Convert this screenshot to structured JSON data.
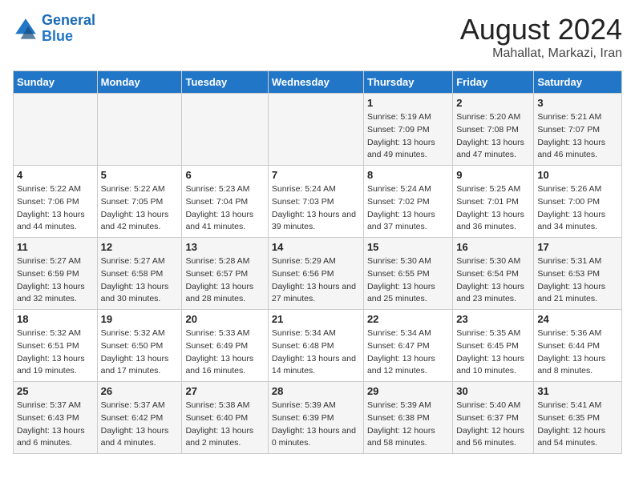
{
  "logo": {
    "line1": "General",
    "line2": "Blue"
  },
  "title": "August 2024",
  "subtitle": "Mahallat, Markazi, Iran",
  "days_of_week": [
    "Sunday",
    "Monday",
    "Tuesday",
    "Wednesday",
    "Thursday",
    "Friday",
    "Saturday"
  ],
  "weeks": [
    [
      {
        "day": "",
        "sunrise": "",
        "sunset": "",
        "daylight": ""
      },
      {
        "day": "",
        "sunrise": "",
        "sunset": "",
        "daylight": ""
      },
      {
        "day": "",
        "sunrise": "",
        "sunset": "",
        "daylight": ""
      },
      {
        "day": "",
        "sunrise": "",
        "sunset": "",
        "daylight": ""
      },
      {
        "day": "1",
        "sunrise": "Sunrise: 5:19 AM",
        "sunset": "Sunset: 7:09 PM",
        "daylight": "Daylight: 13 hours and 49 minutes."
      },
      {
        "day": "2",
        "sunrise": "Sunrise: 5:20 AM",
        "sunset": "Sunset: 7:08 PM",
        "daylight": "Daylight: 13 hours and 47 minutes."
      },
      {
        "day": "3",
        "sunrise": "Sunrise: 5:21 AM",
        "sunset": "Sunset: 7:07 PM",
        "daylight": "Daylight: 13 hours and 46 minutes."
      }
    ],
    [
      {
        "day": "4",
        "sunrise": "Sunrise: 5:22 AM",
        "sunset": "Sunset: 7:06 PM",
        "daylight": "Daylight: 13 hours and 44 minutes."
      },
      {
        "day": "5",
        "sunrise": "Sunrise: 5:22 AM",
        "sunset": "Sunset: 7:05 PM",
        "daylight": "Daylight: 13 hours and 42 minutes."
      },
      {
        "day": "6",
        "sunrise": "Sunrise: 5:23 AM",
        "sunset": "Sunset: 7:04 PM",
        "daylight": "Daylight: 13 hours and 41 minutes."
      },
      {
        "day": "7",
        "sunrise": "Sunrise: 5:24 AM",
        "sunset": "Sunset: 7:03 PM",
        "daylight": "Daylight: 13 hours and 39 minutes."
      },
      {
        "day": "8",
        "sunrise": "Sunrise: 5:24 AM",
        "sunset": "Sunset: 7:02 PM",
        "daylight": "Daylight: 13 hours and 37 minutes."
      },
      {
        "day": "9",
        "sunrise": "Sunrise: 5:25 AM",
        "sunset": "Sunset: 7:01 PM",
        "daylight": "Daylight: 13 hours and 36 minutes."
      },
      {
        "day": "10",
        "sunrise": "Sunrise: 5:26 AM",
        "sunset": "Sunset: 7:00 PM",
        "daylight": "Daylight: 13 hours and 34 minutes."
      }
    ],
    [
      {
        "day": "11",
        "sunrise": "Sunrise: 5:27 AM",
        "sunset": "Sunset: 6:59 PM",
        "daylight": "Daylight: 13 hours and 32 minutes."
      },
      {
        "day": "12",
        "sunrise": "Sunrise: 5:27 AM",
        "sunset": "Sunset: 6:58 PM",
        "daylight": "Daylight: 13 hours and 30 minutes."
      },
      {
        "day": "13",
        "sunrise": "Sunrise: 5:28 AM",
        "sunset": "Sunset: 6:57 PM",
        "daylight": "Daylight: 13 hours and 28 minutes."
      },
      {
        "day": "14",
        "sunrise": "Sunrise: 5:29 AM",
        "sunset": "Sunset: 6:56 PM",
        "daylight": "Daylight: 13 hours and 27 minutes."
      },
      {
        "day": "15",
        "sunrise": "Sunrise: 5:30 AM",
        "sunset": "Sunset: 6:55 PM",
        "daylight": "Daylight: 13 hours and 25 minutes."
      },
      {
        "day": "16",
        "sunrise": "Sunrise: 5:30 AM",
        "sunset": "Sunset: 6:54 PM",
        "daylight": "Daylight: 13 hours and 23 minutes."
      },
      {
        "day": "17",
        "sunrise": "Sunrise: 5:31 AM",
        "sunset": "Sunset: 6:53 PM",
        "daylight": "Daylight: 13 hours and 21 minutes."
      }
    ],
    [
      {
        "day": "18",
        "sunrise": "Sunrise: 5:32 AM",
        "sunset": "Sunset: 6:51 PM",
        "daylight": "Daylight: 13 hours and 19 minutes."
      },
      {
        "day": "19",
        "sunrise": "Sunrise: 5:32 AM",
        "sunset": "Sunset: 6:50 PM",
        "daylight": "Daylight: 13 hours and 17 minutes."
      },
      {
        "day": "20",
        "sunrise": "Sunrise: 5:33 AM",
        "sunset": "Sunset: 6:49 PM",
        "daylight": "Daylight: 13 hours and 16 minutes."
      },
      {
        "day": "21",
        "sunrise": "Sunrise: 5:34 AM",
        "sunset": "Sunset: 6:48 PM",
        "daylight": "Daylight: 13 hours and 14 minutes."
      },
      {
        "day": "22",
        "sunrise": "Sunrise: 5:34 AM",
        "sunset": "Sunset: 6:47 PM",
        "daylight": "Daylight: 13 hours and 12 minutes."
      },
      {
        "day": "23",
        "sunrise": "Sunrise: 5:35 AM",
        "sunset": "Sunset: 6:45 PM",
        "daylight": "Daylight: 13 hours and 10 minutes."
      },
      {
        "day": "24",
        "sunrise": "Sunrise: 5:36 AM",
        "sunset": "Sunset: 6:44 PM",
        "daylight": "Daylight: 13 hours and 8 minutes."
      }
    ],
    [
      {
        "day": "25",
        "sunrise": "Sunrise: 5:37 AM",
        "sunset": "Sunset: 6:43 PM",
        "daylight": "Daylight: 13 hours and 6 minutes."
      },
      {
        "day": "26",
        "sunrise": "Sunrise: 5:37 AM",
        "sunset": "Sunset: 6:42 PM",
        "daylight": "Daylight: 13 hours and 4 minutes."
      },
      {
        "day": "27",
        "sunrise": "Sunrise: 5:38 AM",
        "sunset": "Sunset: 6:40 PM",
        "daylight": "Daylight: 13 hours and 2 minutes."
      },
      {
        "day": "28",
        "sunrise": "Sunrise: 5:39 AM",
        "sunset": "Sunset: 6:39 PM",
        "daylight": "Daylight: 13 hours and 0 minutes."
      },
      {
        "day": "29",
        "sunrise": "Sunrise: 5:39 AM",
        "sunset": "Sunset: 6:38 PM",
        "daylight": "Daylight: 12 hours and 58 minutes."
      },
      {
        "day": "30",
        "sunrise": "Sunrise: 5:40 AM",
        "sunset": "Sunset: 6:37 PM",
        "daylight": "Daylight: 12 hours and 56 minutes."
      },
      {
        "day": "31",
        "sunrise": "Sunrise: 5:41 AM",
        "sunset": "Sunset: 6:35 PM",
        "daylight": "Daylight: 12 hours and 54 minutes."
      }
    ]
  ]
}
